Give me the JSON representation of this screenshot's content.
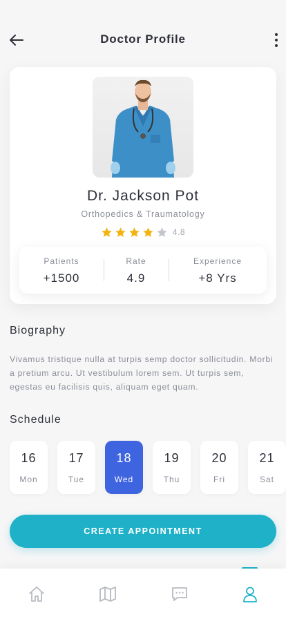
{
  "header": {
    "title": "Doctor Profile",
    "back_icon": "arrow-left-icon",
    "more_icon": "more-vertical-icon"
  },
  "doctor": {
    "name": "Dr. Jackson Pot",
    "specialty": "Orthopedics & Traumatology",
    "rating": 4.8,
    "rating_label": "4.8",
    "stars_filled": 4,
    "stars_total": 5
  },
  "stats": [
    {
      "label": "Patients",
      "value": "+1500"
    },
    {
      "label": "Rate",
      "value": "4.9"
    },
    {
      "label": "Experience",
      "value": "+8 Yrs"
    }
  ],
  "biography": {
    "title": "Biography",
    "text": "Vivamus tristique nulla at turpis semp doctor sollicitudin. Morbi a pretium arcu. Ut vestibulum lorem sem. Ut turpis sem, egestas eu facilisis quis, aliquam eget quam."
  },
  "schedule": {
    "title": "Schedule",
    "days": [
      {
        "num": "16",
        "name": "Mon",
        "selected": false
      },
      {
        "num": "17",
        "name": "Tue",
        "selected": false
      },
      {
        "num": "18",
        "name": "Wed",
        "selected": true
      },
      {
        "num": "19",
        "name": "Thu",
        "selected": false
      },
      {
        "num": "20",
        "name": "Fri",
        "selected": false
      },
      {
        "num": "21",
        "name": "Sat",
        "selected": false
      }
    ]
  },
  "cta": {
    "label": "CREATE APPOINTMENT"
  },
  "nav": {
    "items": [
      {
        "icon": "home-icon",
        "active": false
      },
      {
        "icon": "map-icon",
        "active": false
      },
      {
        "icon": "chat-icon",
        "active": false
      },
      {
        "icon": "user-icon",
        "active": true
      }
    ]
  },
  "colors": {
    "accent": "#1eb1c7",
    "selected_day": "#3f64e0",
    "star": "#f5b311",
    "star_empty": "#c2c5cb",
    "text_primary": "#2d3038",
    "text_muted": "#8a8e97"
  }
}
